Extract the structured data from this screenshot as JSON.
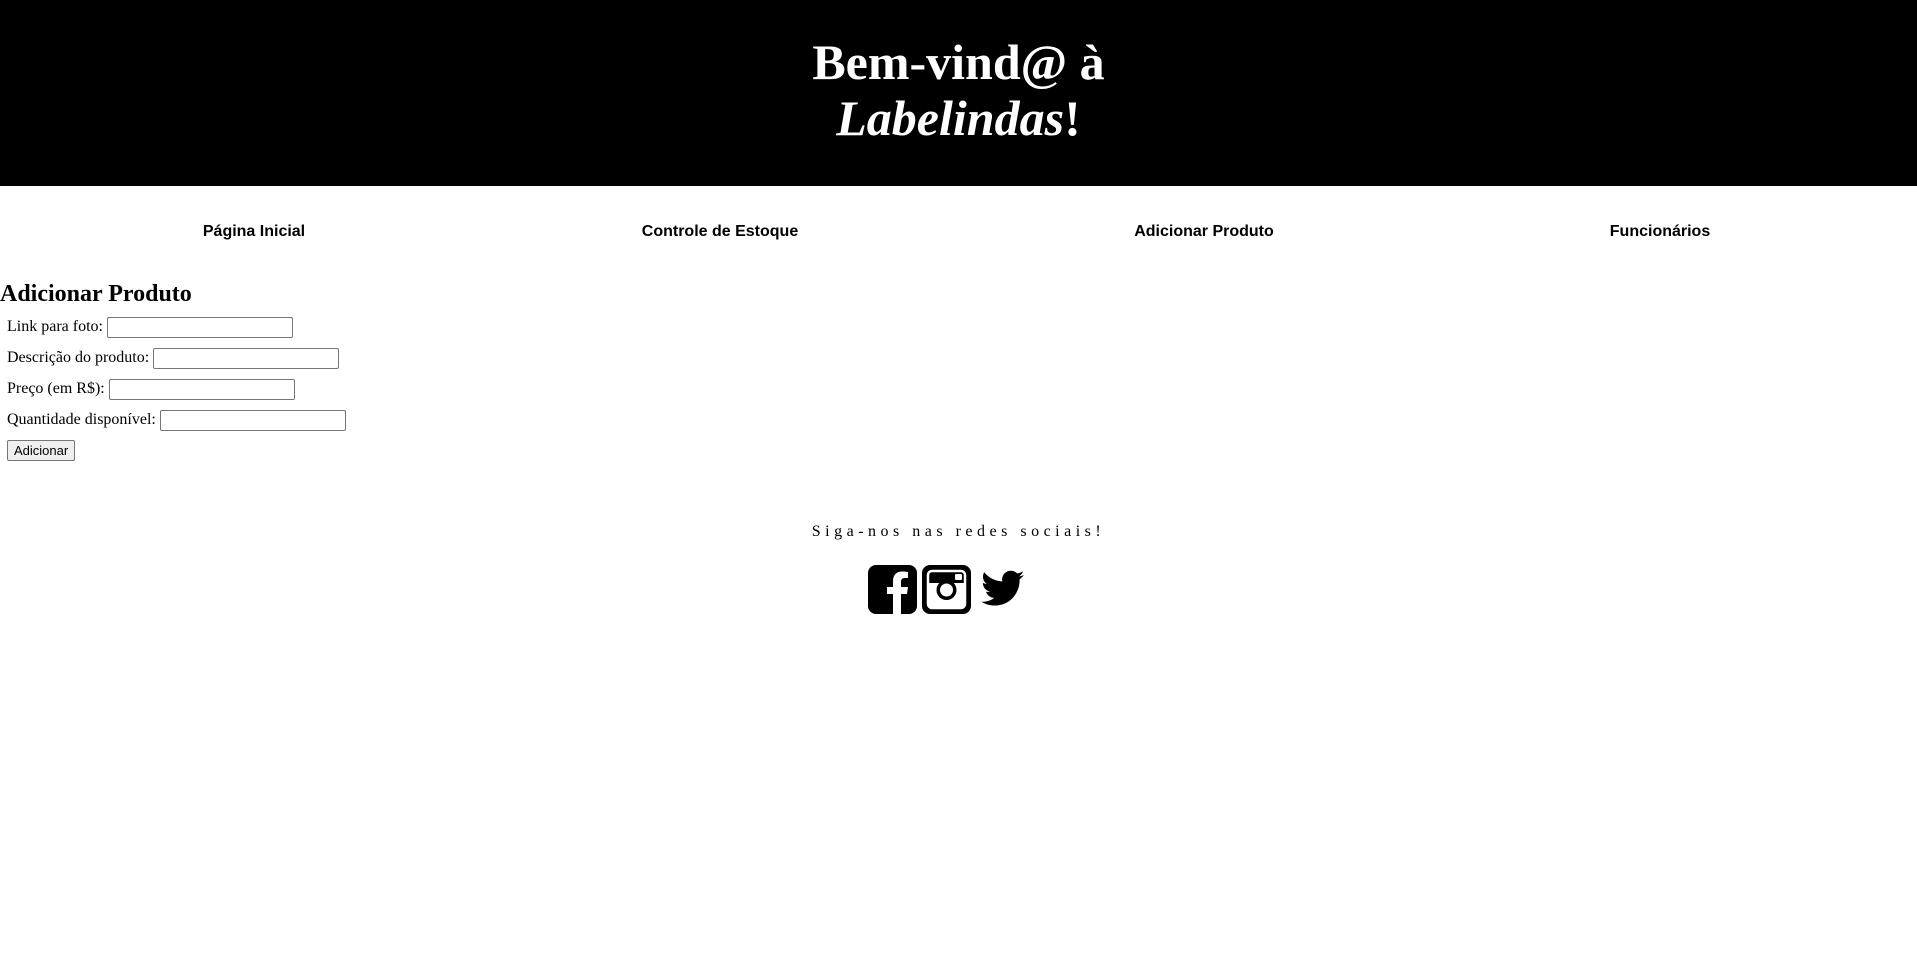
{
  "header": {
    "title_line1": "Bem-vind@ à",
    "brand": "Labelindas",
    "exclaim": "!"
  },
  "nav": {
    "items": [
      {
        "label": "Página Inicial"
      },
      {
        "label": "Controle de Estoque"
      },
      {
        "label": "Adicionar Produto"
      },
      {
        "label": "Funcionários"
      }
    ]
  },
  "form": {
    "title": "Adicionar Produto",
    "fields": [
      {
        "label": "Link para foto:",
        "value": ""
      },
      {
        "label": "Descrição do produto:",
        "value": ""
      },
      {
        "label": "Preço (em R$):",
        "value": ""
      },
      {
        "label": "Quantidade disponível:",
        "value": ""
      }
    ],
    "submit_label": "Adicionar"
  },
  "footer": {
    "social_text": "Siga-nos nas redes sociais!",
    "icons": [
      "facebook-icon",
      "instagram-icon",
      "twitter-icon"
    ]
  },
  "colors": {
    "header_bg": "#000000",
    "header_text": "#ffffff",
    "page_bg": "#ffffff"
  }
}
